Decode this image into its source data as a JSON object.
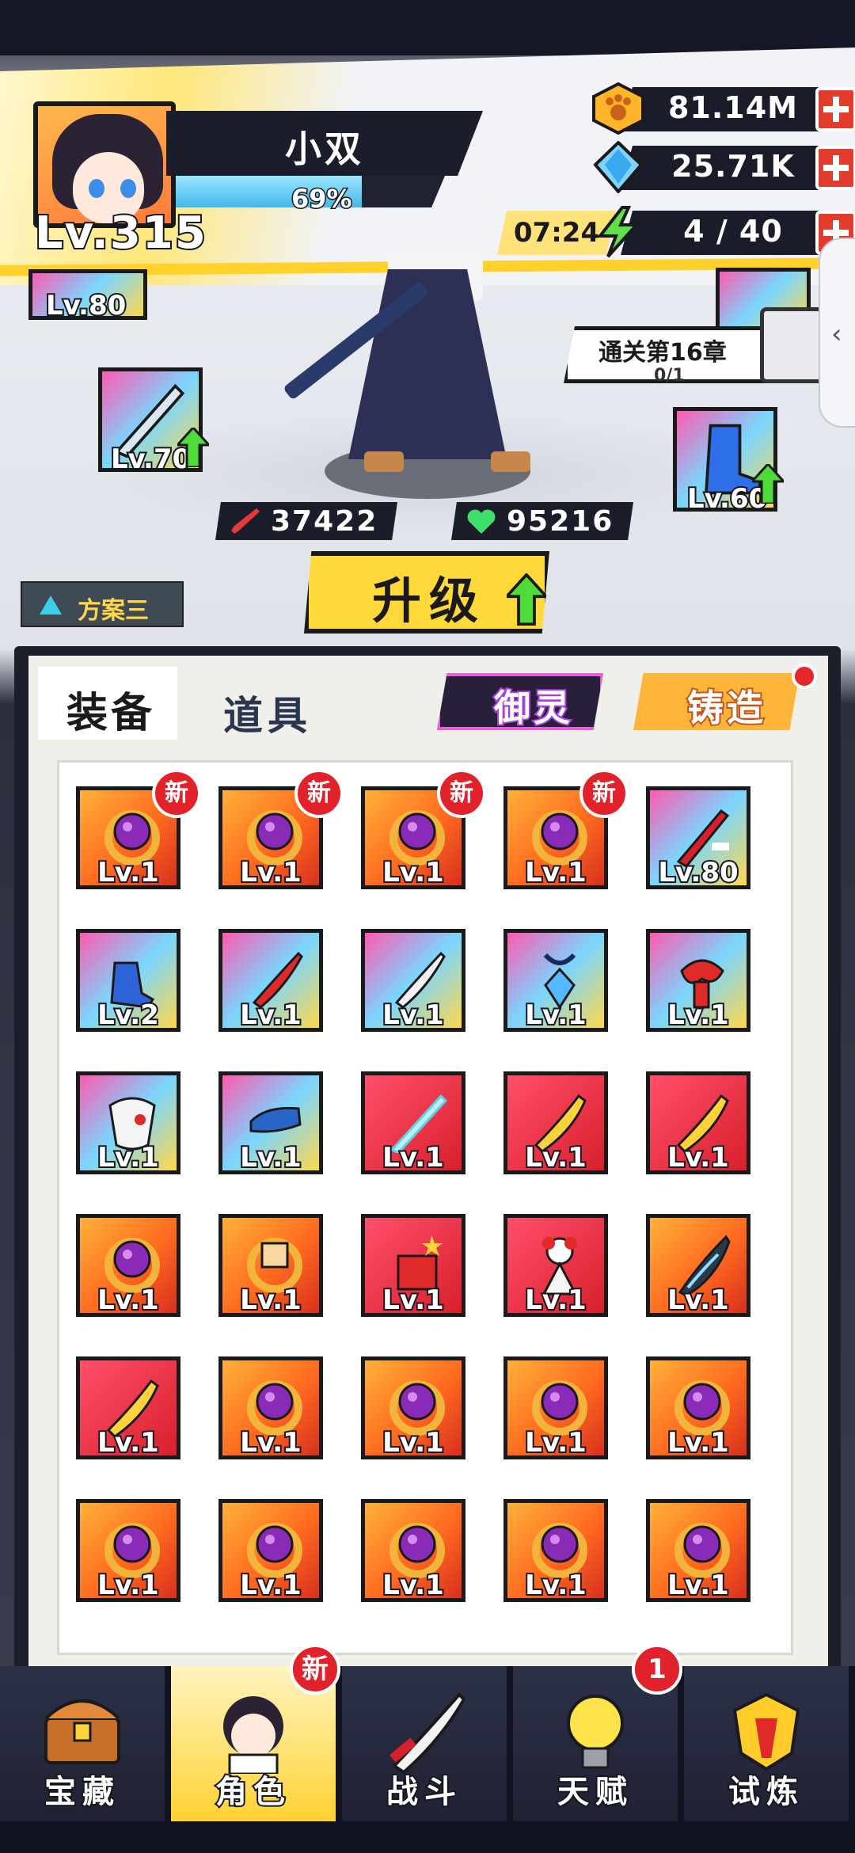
{
  "player": {
    "name": "小双",
    "level": "Lv.315",
    "xp_percent": "69%",
    "xp_fraction": 0.69
  },
  "resources": {
    "gold": "81.14M",
    "gems": "25.71K",
    "energy_timer": "07:24",
    "energy": "4 / 40"
  },
  "equipped": {
    "top_left_lv": "Lv.80",
    "left_weapon_lv": "Lv.70",
    "right_boots_lv": "Lv.60"
  },
  "stats": {
    "attack": "37422",
    "hp": "95216"
  },
  "chapter": {
    "title": "通关第16章",
    "progress": "0/1"
  },
  "plan_label": "方案三",
  "upgrade_label": "升级",
  "tabs": {
    "equipment": "装备",
    "items": "道具",
    "spirit": "御灵",
    "forge": "铸造"
  },
  "new_label": "新",
  "inventory": [
    {
      "lv": "Lv.1",
      "icon": "ring-purple-icon",
      "new": true
    },
    {
      "lv": "Lv.1",
      "icon": "ring-purple-icon",
      "new": true
    },
    {
      "lv": "Lv.1",
      "icon": "ring-purple-icon",
      "new": true
    },
    {
      "lv": "Lv.1",
      "icon": "ring-purple-icon",
      "new": true
    },
    {
      "lv": "Lv.80",
      "icon": "red-katana-icon",
      "new": false
    },
    {
      "lv": "Lv.2",
      "icon": "blue-gloves-icon",
      "new": false
    },
    {
      "lv": "Lv.1",
      "icon": "red-blade-icon",
      "new": false
    },
    {
      "lv": "Lv.1",
      "icon": "white-blade-icon",
      "new": false
    },
    {
      "lv": "Lv.1",
      "icon": "blue-amulet-icon",
      "new": false
    },
    {
      "lv": "Lv.1",
      "icon": "red-scarf-icon",
      "new": false
    },
    {
      "lv": "Lv.1",
      "icon": "white-mask-icon",
      "new": false
    },
    {
      "lv": "Lv.1",
      "icon": "blue-boot-icon",
      "new": false
    },
    {
      "lv": "Lv.1",
      "icon": "light-sword-icon",
      "new": false
    },
    {
      "lv": "Lv.1",
      "icon": "yellow-sword-icon",
      "new": false
    },
    {
      "lv": "Lv.1",
      "icon": "yellow-sword-icon",
      "new": false
    },
    {
      "lv": "Lv.1",
      "icon": "ring-purple-icon",
      "new": false
    },
    {
      "lv": "Lv.1",
      "icon": "ring-gold-icon",
      "new": false
    },
    {
      "lv": "Lv.1",
      "icon": "firecracker-icon",
      "new": false
    },
    {
      "lv": "Lv.1",
      "icon": "doll-icon",
      "new": false
    },
    {
      "lv": "Lv.1",
      "icon": "dark-blade-icon",
      "new": false
    },
    {
      "lv": "Lv.1",
      "icon": "yellow-sword-icon",
      "new": false
    },
    {
      "lv": "Lv.1",
      "icon": "ring-purple-icon",
      "new": false
    },
    {
      "lv": "Lv.1",
      "icon": "ring-purple-icon",
      "new": false
    },
    {
      "lv": "Lv.1",
      "icon": "ring-purple-icon",
      "new": false
    },
    {
      "lv": "Lv.1",
      "icon": "ring-purple-icon",
      "new": false
    },
    {
      "lv": "Lv.1",
      "icon": "ring-purple-icon",
      "new": false
    },
    {
      "lv": "Lv.1",
      "icon": "ring-purple-icon",
      "new": false
    },
    {
      "lv": "Lv.1",
      "icon": "ring-purple-icon",
      "new": false
    },
    {
      "lv": "Lv.1",
      "icon": "ring-purple-icon",
      "new": false
    },
    {
      "lv": "Lv.1",
      "icon": "ring-purple-icon",
      "new": false
    }
  ],
  "nav": [
    {
      "label": "宝藏",
      "icon": "treasure-chest-icon",
      "badge": ""
    },
    {
      "label": "角色",
      "icon": "character-icon",
      "badge": "新"
    },
    {
      "label": "战斗",
      "icon": "battle-sword-icon",
      "badge": ""
    },
    {
      "label": "天赋",
      "icon": "lightbulb-icon",
      "badge": "1"
    },
    {
      "label": "试炼",
      "icon": "trial-helmet-icon",
      "badge": ""
    }
  ],
  "colors": {
    "accent_yellow": "#ffd93a",
    "badge_red": "#e2222b",
    "panel_dark": "#1c1e29"
  }
}
